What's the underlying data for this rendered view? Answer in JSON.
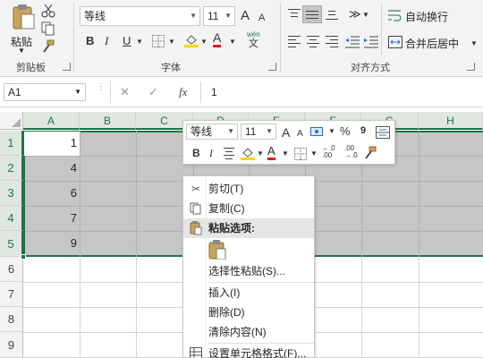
{
  "ribbon": {
    "clipboard": {
      "paste_label": "粘贴",
      "group_label": "剪贴板"
    },
    "font": {
      "font_name": "等线",
      "font_size": "11",
      "grow_icon": "A",
      "shrink_icon": "A",
      "bold": "B",
      "italic": "I",
      "underline": "U",
      "phonetic_top": "wén",
      "phonetic_bottom": "文",
      "group_label": "字体"
    },
    "alignment": {
      "wrap_text_label": "自动换行",
      "merge_center_label": "合并后居中",
      "group_label": "对齐方式"
    }
  },
  "formula_bar": {
    "name_box": "A1",
    "cancel": "✕",
    "enter": "✓",
    "fx": "fx",
    "value": "1"
  },
  "sheet": {
    "columns": [
      "A",
      "B",
      "C",
      "D",
      "E",
      "F",
      "G",
      "H"
    ],
    "rows": [
      "1",
      "2",
      "3",
      "4",
      "5",
      "6",
      "7",
      "8",
      "9"
    ],
    "values": [
      "1",
      "4",
      "6",
      "7",
      "9"
    ]
  },
  "mini_toolbar": {
    "font_name": "等线",
    "font_size": "11",
    "grow": "A",
    "shrink": "A",
    "percent": "%",
    "comma": "9",
    "bold": "B",
    "italic": "I",
    "inc_decimal_top": "←.0",
    "inc_decimal_bottom": ".00",
    "dec_decimal_top": ".00",
    "dec_decimal_bottom": "→.0"
  },
  "context_menu": {
    "items": [
      {
        "label": "剪切(T)",
        "icon": "scissors-icon"
      },
      {
        "label": "复制(C)",
        "icon": "copy-icon"
      },
      {
        "label": "粘贴选项:",
        "icon": "paste-icon"
      },
      {
        "label": "选择性粘贴(S)...",
        "icon": ""
      },
      {
        "label": "插入(I)",
        "icon": ""
      },
      {
        "label": "删除(D)",
        "icon": ""
      },
      {
        "label": "清除内容(N)",
        "icon": ""
      },
      {
        "label": "设置单元格格式(F)...",
        "icon": "format-cells-icon"
      }
    ]
  },
  "colors": {
    "accent_green": "#217346",
    "font_color_red": "#e81123",
    "highlight_yellow": "#ffd400",
    "selection_gray": "#c6c6c6"
  }
}
